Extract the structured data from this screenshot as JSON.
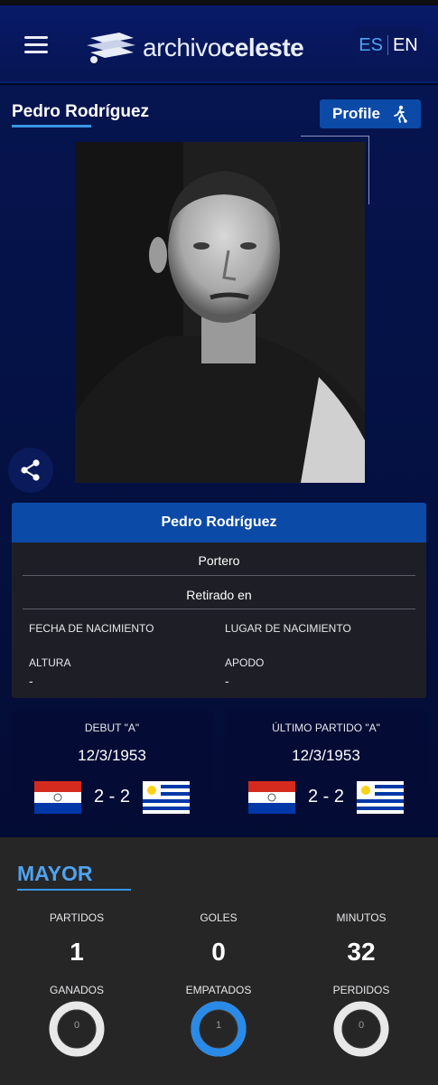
{
  "header": {
    "logo": {
      "prefix": "archivo",
      "suffix": "celeste"
    },
    "lang": [
      "ES",
      "EN"
    ]
  },
  "player": {
    "name": "Pedro Rodríguez",
    "profile_label": "Profile",
    "card": {
      "name": "Pedro Rodríguez",
      "position": "Portero",
      "retired": "Retirado en",
      "birth_date_label": "FECHA DE NACIMIENTO",
      "birth_place_label": "LUGAR DE NACIMIENTO",
      "height_label": "ALTURA",
      "height_value": "-",
      "nickname_label": "APODO",
      "nickname_value": "-"
    }
  },
  "matches": [
    {
      "label": "DEBUT \"A\"",
      "date": "12/3/1953",
      "score": "2 - 2",
      "home_flag": "paraguay-flag",
      "away_flag": "uruguay-flag"
    },
    {
      "label": "ÚLTIMO PARTIDO \"A\"",
      "date": "12/3/1953",
      "score": "2 - 2",
      "home_flag": "paraguay-flag",
      "away_flag": "uruguay-flag"
    }
  ],
  "stats": {
    "title": "MAYOR",
    "items": [
      {
        "label": "PARTIDOS",
        "value": "1"
      },
      {
        "label": "GOLES",
        "value": "0"
      },
      {
        "label": "MINUTOS",
        "value": "32"
      }
    ],
    "results": [
      {
        "label": "GANADOS",
        "value": "0",
        "fraction": 0
      },
      {
        "label": "EMPATADOS",
        "value": "1",
        "fraction": 1
      },
      {
        "label": "PERDIDOS",
        "value": "0",
        "fraction": 0
      }
    ]
  },
  "colors": {
    "accent": "#4fa3f0",
    "header_bg": "#091a6a",
    "card_header": "#0b4aa6",
    "donut_active": "#2a8ae8",
    "donut_empty": "#e8e8e8"
  }
}
